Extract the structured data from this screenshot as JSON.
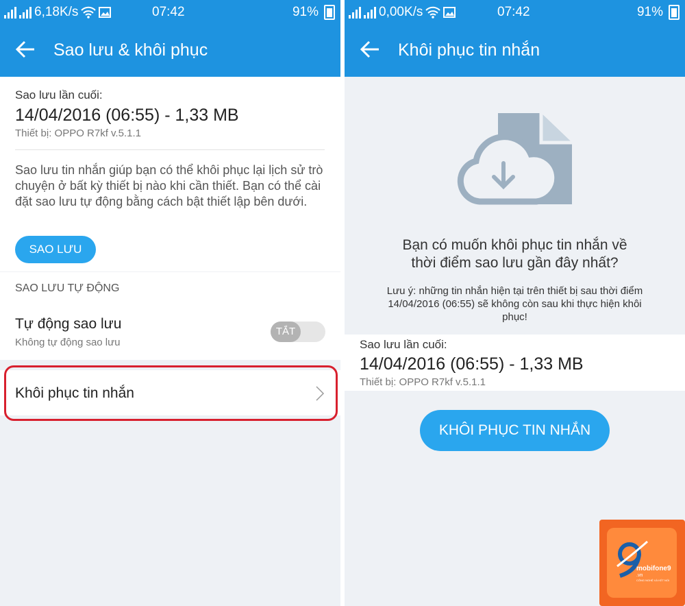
{
  "left": {
    "status": {
      "speed": "6,18K/s",
      "time": "07:42",
      "battery": "91%"
    },
    "title": "Sao lưu & khôi phục",
    "last_backup_label": "Sao lưu lần cuối:",
    "last_backup_value": "14/04/2016 (06:55) - 1,33 MB",
    "device": "Thiết bị: OPPO R7kf v.5.1.1",
    "description": "Sao lưu tin nhắn giúp bạn có thể khôi phục lại lịch sử trò chuyện ở bất kỳ thiết bị nào khi cần thiết. Bạn có thể cài đặt sao lưu tự động bằng cách bật thiết lập bên dưới.",
    "backup_button": "SAO LƯU",
    "auto_section": "SAO LƯU TỰ ĐỘNG",
    "auto_title": "Tự động sao lưu",
    "auto_subtitle": "Không tự động sao lưu",
    "toggle_label": "TẮT",
    "restore_row": "Khôi phục tin nhắn"
  },
  "right": {
    "status": {
      "speed": "0,00K/s",
      "time": "07:42",
      "battery": "91%"
    },
    "title": "Khôi phục tin nhắn",
    "question": "Bạn có muốn khôi phục tin nhắn về thời điểm sao lưu gần đây nhất?",
    "note": "Lưu ý: những tin nhắn hiện tại trên thiết bị sau thời điểm 14/04/2016 (06:55) sẽ không còn sau khi thực hiện khôi phục!",
    "last_backup_label": "Sao lưu lần cuối:",
    "last_backup_value": "14/04/2016 (06:55) - 1,33 MB",
    "device": "Thiết bị: OPPO R7kf v.5.1.1",
    "restore_button": "KHÔI PHỤC TIN NHẮN"
  },
  "logo": {
    "brand": "mobifone9",
    "domain": ".vn",
    "tagline": "CÔNG NGHỆ VÀ KẾT NỐI"
  },
  "colors": {
    "accent": "#1e93e0",
    "button": "#2aa6ee",
    "highlight": "#d8202e"
  },
  "icons": [
    "back-arrow-icon",
    "wifi-icon",
    "image-icon",
    "chevron-right-icon",
    "cloud-download-icon",
    "document-icon"
  ]
}
